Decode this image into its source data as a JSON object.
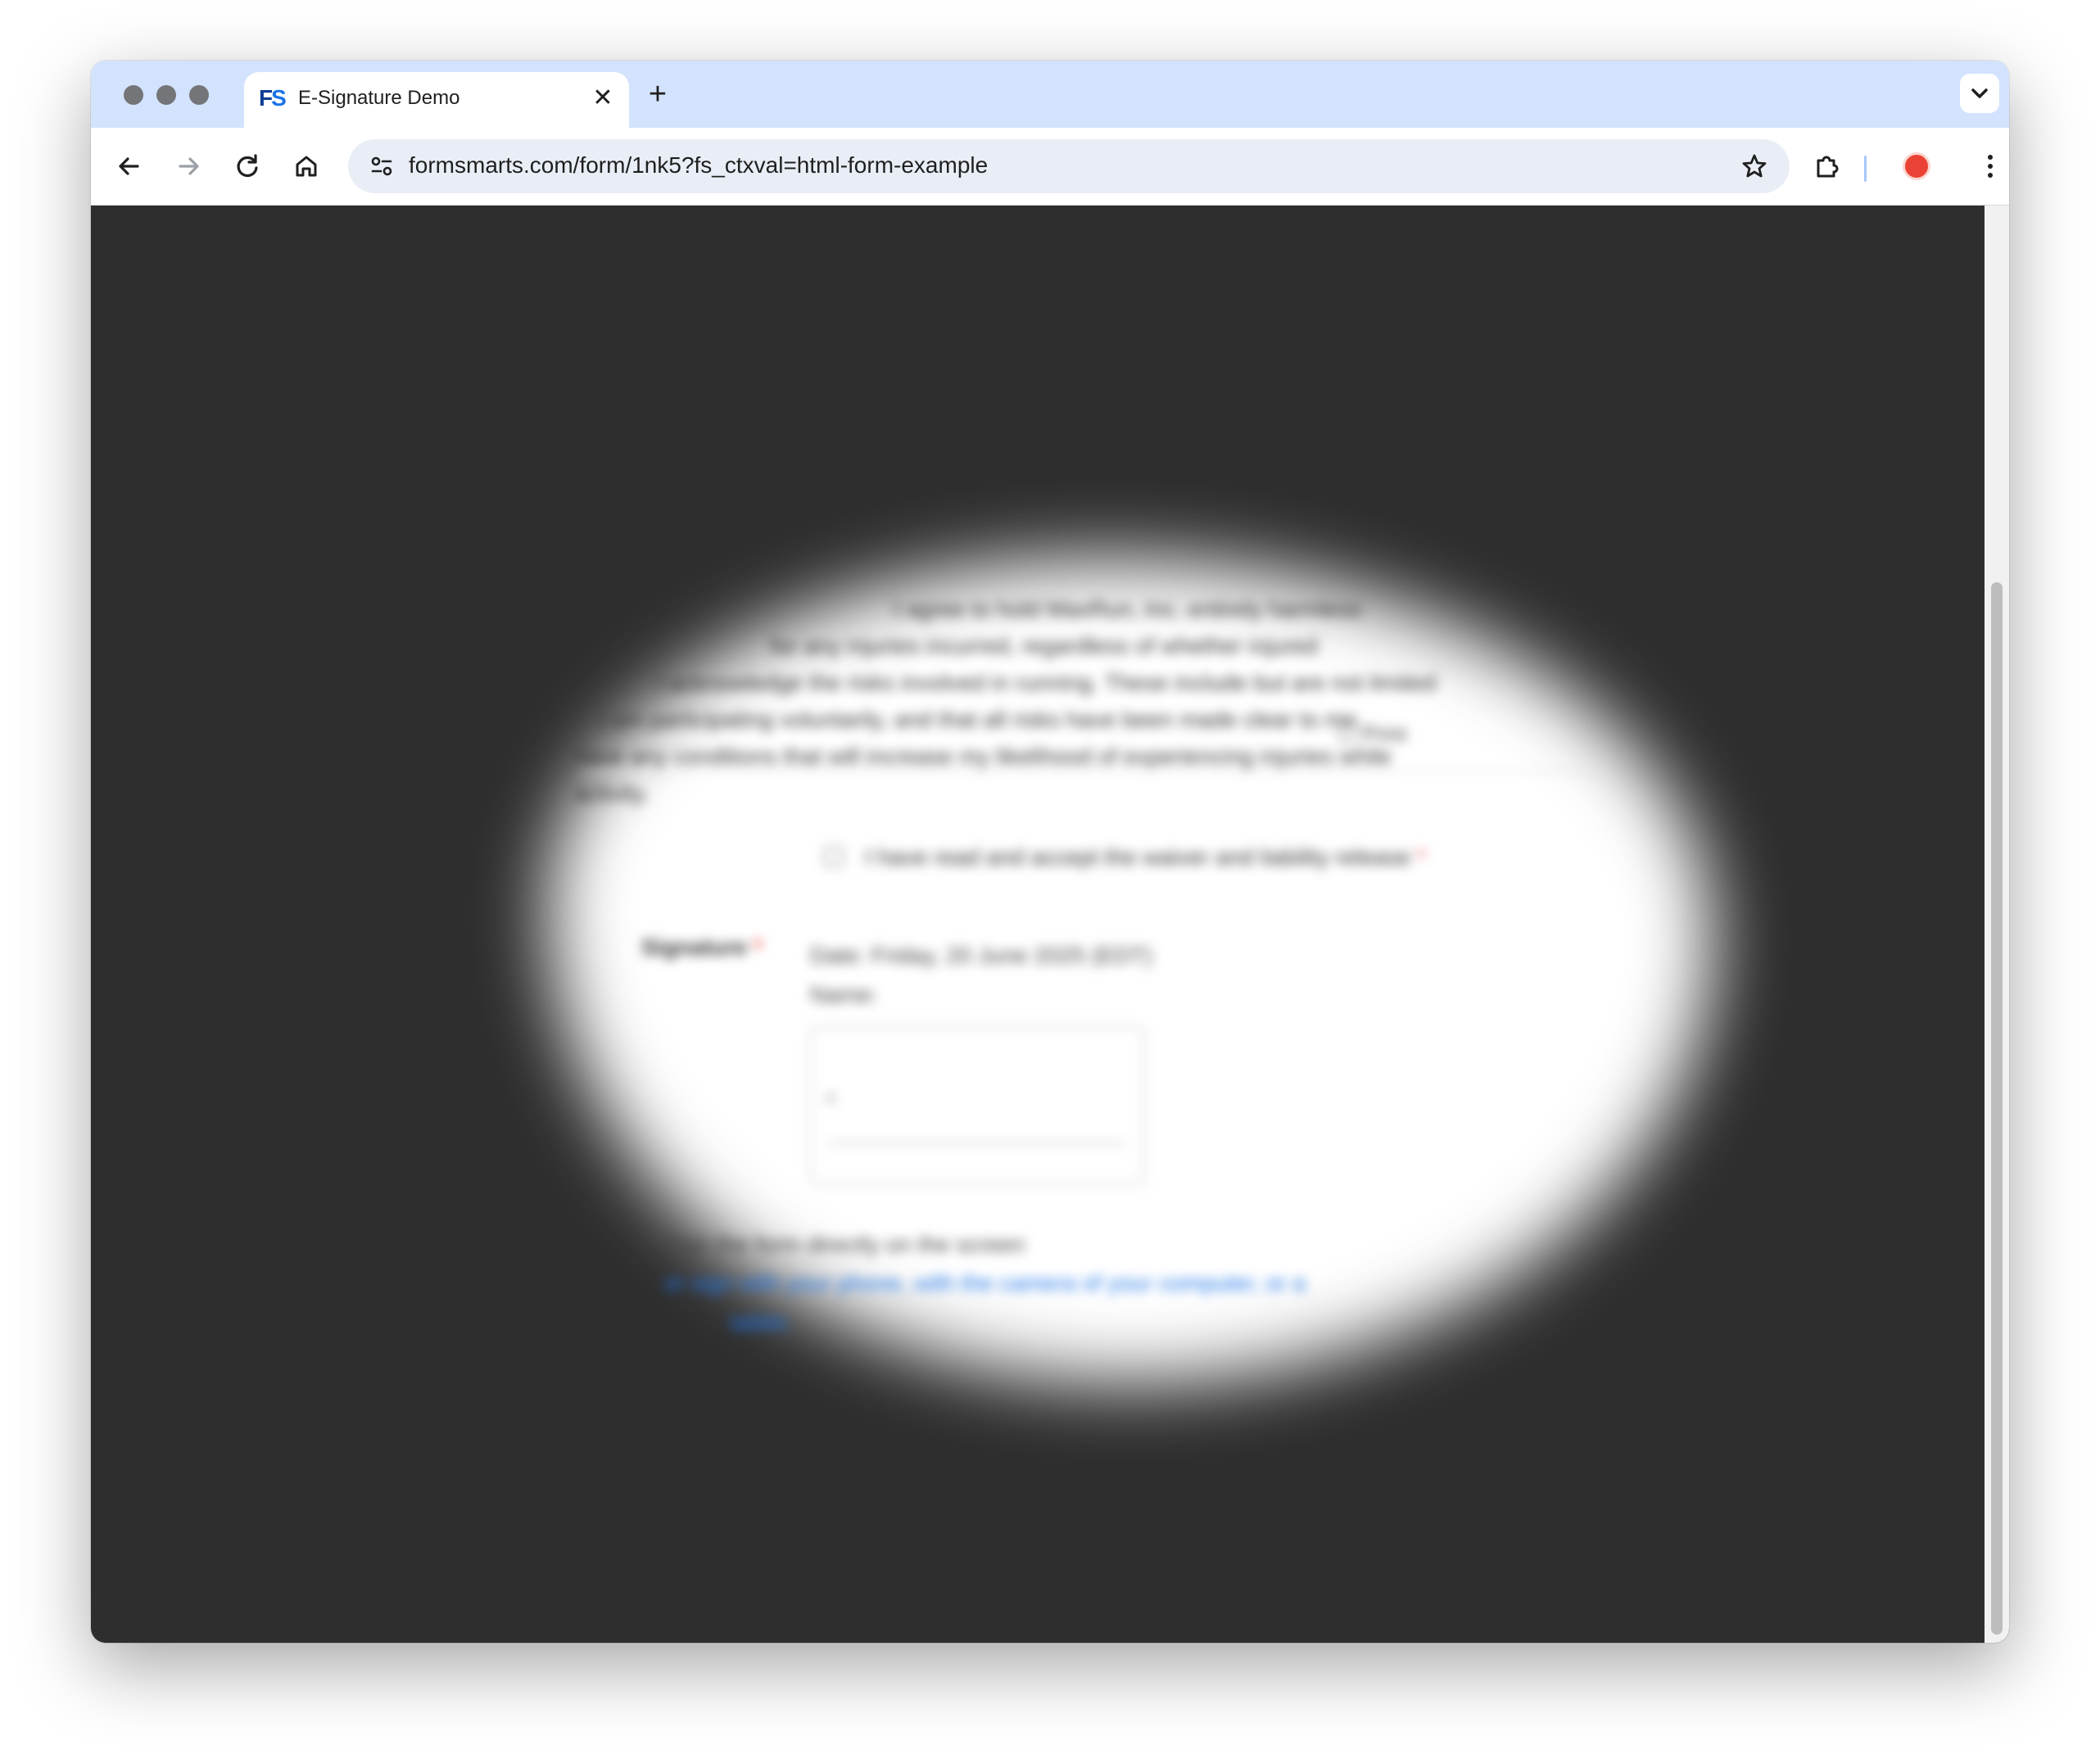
{
  "browser": {
    "tab": {
      "title": "E-Signature Demo",
      "favicon_f": "F",
      "favicon_s": "S",
      "close_glyph": "✕"
    },
    "new_tab_glyph": "+",
    "address_bar": {
      "url": "formsmarts.com/form/1nk5?fs_ctxval=html-form-example"
    },
    "icons": [
      "back-icon",
      "forward-icon",
      "reload-icon",
      "home-icon",
      "site-settings-icon",
      "bookmark-star-icon",
      "extensions-icon",
      "profile-avatar",
      "more-menu-icon",
      "tab-search-icon"
    ]
  },
  "page": {
    "waiver_text": [
      "I agree to hold MaxRun, Inc. entirely harmless",
      "for any injuries incurred, regardless of whether injured",
      "I acknowledge the risks involved in running. These include but are not limited",
      "I am participating voluntarily, and that all risks have been made clear to me.",
      "have any conditions that will increase my likelihood of experiencing injuries while",
      "activity."
    ],
    "print_link": "Print",
    "accept_checkbox_label": "I have read and accept the waiver and liability release",
    "required_mark": "*",
    "signature_label": "Signature",
    "signature_date": "Date: Friday, 20 June 2025 (EDT)",
    "signature_name_label": "Name:",
    "signature_x": "x",
    "instructions": {
      "line1": "Sign the form directly on the screen",
      "line2": "or sign with your phone, with the camera of your computer, or a",
      "line3": "tablet."
    }
  },
  "colors": {
    "tabstrip": "#d3e3fd",
    "overlay": "#2e2e2e",
    "link": "#1a73e8",
    "required": "#e53935"
  }
}
